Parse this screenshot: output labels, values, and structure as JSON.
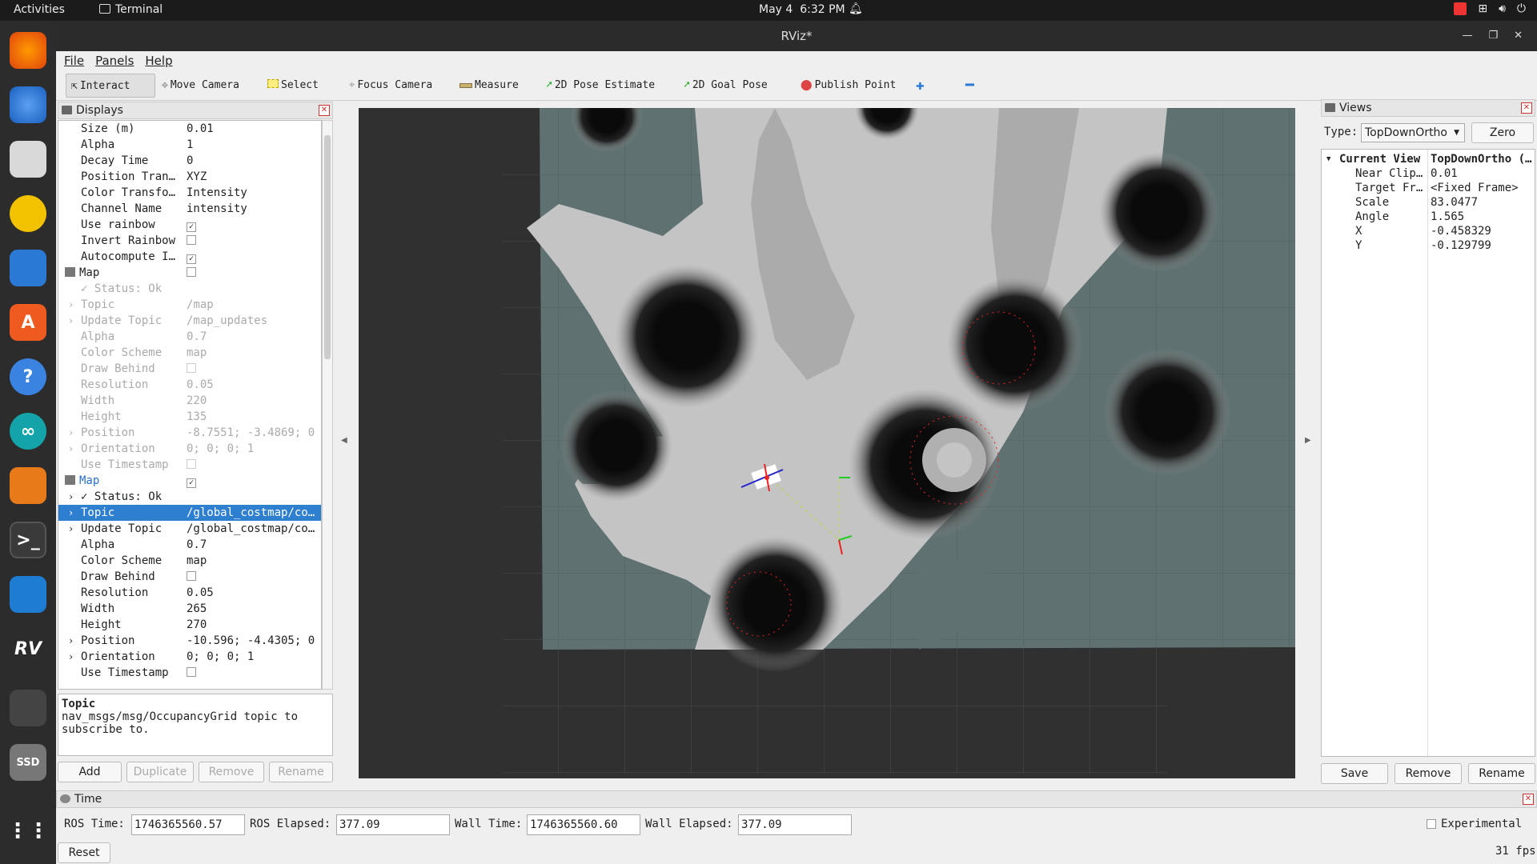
{
  "system": {
    "activities": "Activities",
    "app_name": "Terminal",
    "date": "May 4",
    "time": "6:32 PM"
  },
  "window": {
    "title": "RViz*"
  },
  "menu": [
    "File",
    "Panels",
    "Help"
  ],
  "toolbar": [
    {
      "label": "Interact",
      "icon": "cursor-icon"
    },
    {
      "label": "Move Camera",
      "icon": "move-icon"
    },
    {
      "label": "Select",
      "icon": "select-icon"
    },
    {
      "label": "Focus Camera",
      "icon": "focus-icon"
    },
    {
      "label": "Measure",
      "icon": "ruler-icon"
    },
    {
      "label": "2D Pose Estimate",
      "icon": "green-arrow-icon"
    },
    {
      "label": "2D Goal Pose",
      "icon": "green-arrow-icon"
    },
    {
      "label": "Publish Point",
      "icon": "pin-icon"
    }
  ],
  "displays": {
    "title": "Displays",
    "rows": [
      {
        "k": "Size (m)",
        "v": "0.01",
        "ind": 1
      },
      {
        "k": "Alpha",
        "v": "1",
        "ind": 1
      },
      {
        "k": "Decay Time",
        "v": "0",
        "ind": 1
      },
      {
        "k": "Position Tran…",
        "v": "XYZ",
        "ind": 1
      },
      {
        "k": "Color Transfo…",
        "v": "Intensity",
        "ind": 1
      },
      {
        "k": "Channel Name",
        "v": "intensity",
        "ind": 1
      },
      {
        "k": "Use rainbow",
        "cb": "✓",
        "ind": 1
      },
      {
        "k": "Invert Rainbow",
        "cb": "",
        "ind": 1
      },
      {
        "k": "Autocompute I…",
        "cb": "✓",
        "ind": 1
      },
      {
        "k": "Map",
        "cb": "",
        "ind": 0,
        "icon": true
      },
      {
        "k": "✓ Status: Ok",
        "v": "",
        "ind": 1,
        "dis": true
      },
      {
        "k": "Topic",
        "v": "/map",
        "ind": 1,
        "dis": true,
        "arrow": true
      },
      {
        "k": "Update Topic",
        "v": "/map_updates",
        "ind": 1,
        "dis": true,
        "arrow": true
      },
      {
        "k": "Alpha",
        "v": "0.7",
        "ind": 1,
        "dis": true
      },
      {
        "k": "Color Scheme",
        "v": "map",
        "ind": 1,
        "dis": true
      },
      {
        "k": "Draw Behind",
        "cb": "",
        "ind": 1,
        "dis": true
      },
      {
        "k": "Resolution",
        "v": "0.05",
        "ind": 1,
        "dis": true
      },
      {
        "k": "Width",
        "v": "220",
        "ind": 1,
        "dis": true
      },
      {
        "k": "Height",
        "v": "135",
        "ind": 1,
        "dis": true
      },
      {
        "k": "Position",
        "v": "-8.7551; -3.4869; 0",
        "ind": 1,
        "dis": true,
        "arrow": true
      },
      {
        "k": "Orientation",
        "v": "0; 0; 0; 1",
        "ind": 1,
        "dis": true,
        "arrow": true
      },
      {
        "k": "Use Timestamp",
        "cb": "",
        "ind": 1,
        "dis": true
      },
      {
        "k": "Map",
        "cb": "✓",
        "ind": 0,
        "icon": true,
        "blue": true
      },
      {
        "k": "✓ Status: Ok",
        "v": "",
        "ind": 1,
        "arrow": true
      },
      {
        "k": "Topic",
        "v": "/global_costmap/co…",
        "ind": 1,
        "hl": true,
        "arrow": true
      },
      {
        "k": "Update Topic",
        "v": "/global_costmap/co…",
        "ind": 1,
        "arrow": true
      },
      {
        "k": "Alpha",
        "v": "0.7",
        "ind": 1
      },
      {
        "k": "Color Scheme",
        "v": "map",
        "ind": 1
      },
      {
        "k": "Draw Behind",
        "cb": "",
        "ind": 1
      },
      {
        "k": "Resolution",
        "v": "0.05",
        "ind": 1
      },
      {
        "k": "Width",
        "v": "265",
        "ind": 1
      },
      {
        "k": "Height",
        "v": "270",
        "ind": 1
      },
      {
        "k": "Position",
        "v": "-10.596; -4.4305; 0",
        "ind": 1,
        "arrow": true
      },
      {
        "k": "Orientation",
        "v": "0; 0; 0; 1",
        "ind": 1,
        "arrow": true
      },
      {
        "k": "Use Timestamp",
        "cb": "",
        "ind": 1
      }
    ],
    "desc_title": "Topic",
    "desc_text": "nav_msgs/msg/OccupancyGrid topic to subscribe to.",
    "buttons": [
      "Add",
      "Duplicate",
      "Remove",
      "Rename"
    ]
  },
  "views": {
    "title": "Views",
    "type_label": "Type:",
    "type_value": "TopDownOrtho",
    "zero": "Zero",
    "current_view": "Current View",
    "current_type": "TopDownOrtho (…",
    "props": [
      {
        "k": "Near Clip…",
        "v": "0.01"
      },
      {
        "k": "Target Fr…",
        "v": "<Fixed Frame>"
      },
      {
        "k": "Scale",
        "v": "83.0477"
      },
      {
        "k": "Angle",
        "v": "1.565"
      },
      {
        "k": "X",
        "v": "-0.458329"
      },
      {
        "k": "Y",
        "v": "-0.129799"
      }
    ],
    "buttons": [
      "Save",
      "Remove",
      "Rename"
    ]
  },
  "time": {
    "title": "Time",
    "ros_time_label": "ROS Time:",
    "ros_time": "1746365560.57",
    "ros_elapsed_label": "ROS Elapsed:",
    "ros_elapsed": "377.09",
    "wall_time_label": "Wall Time:",
    "wall_time": "1746365560.60",
    "wall_elapsed_label": "Wall Elapsed:",
    "wall_elapsed": "377.09",
    "experimental": "Experimental",
    "reset": "Reset",
    "fps": "31 fps"
  }
}
